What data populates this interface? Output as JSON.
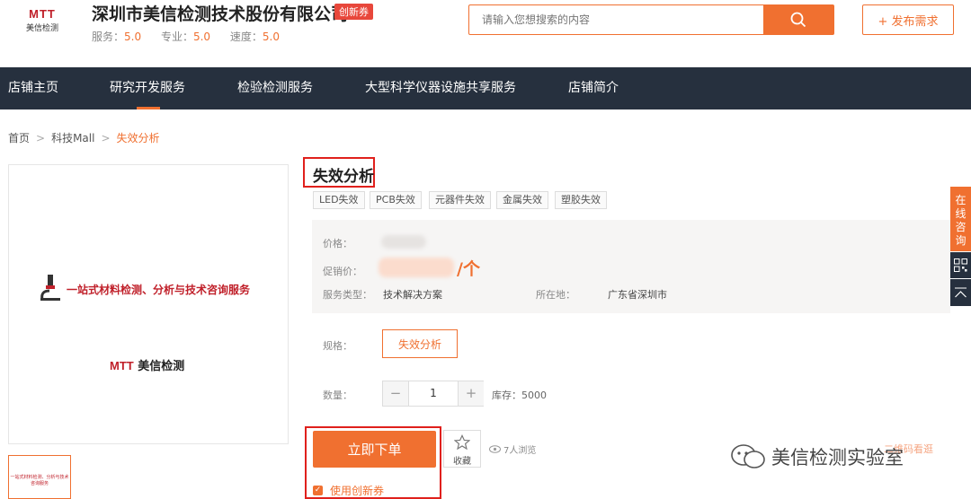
{
  "header": {
    "logo_mark": "MTT",
    "logo_sub": "美信检测",
    "shop_name": "深圳市美信检测技术股份有限公司",
    "badge": "创新券",
    "ratings": [
      {
        "label": "服务：",
        "value": "5.0"
      },
      {
        "label": "专业：",
        "value": "5.0"
      },
      {
        "label": "速度：",
        "value": "5.0"
      }
    ],
    "search_placeholder": "请输入您想搜索的内容",
    "publish_label": "+ 发布需求"
  },
  "nav": {
    "items": [
      "店铺主页",
      "研究开发服务",
      "检验检测服务",
      "大型科学仪器设施共享服务",
      "店铺简介"
    ],
    "active": "研究开发服务"
  },
  "breadcrumb": {
    "items": [
      "首页",
      "科技Mall",
      "失效分析"
    ]
  },
  "gallery": {
    "banner_text": "一站式材料检测、分析与技术咨询服务",
    "logo_mark": "MTT",
    "logo_text": "美信检测",
    "thumb_text": "一站式材料检测、分析与技术咨询服务"
  },
  "product": {
    "title": "失效分析",
    "tags": [
      "LED失效",
      "PCB失效",
      "元器件失效",
      "金属失效",
      "塑胶失效"
    ],
    "price_label": "价格：",
    "promo_label": "促销价：",
    "promo_unit": "/个",
    "service_type_label": "服务类型：",
    "service_type_value": "技术解决方案",
    "location_label": "所在地：",
    "location_value": "广东省深圳市",
    "spec_label": "规格：",
    "spec_value": "失效分析",
    "qty_label": "数量：",
    "qty_minus": "−",
    "qty_value": "1",
    "qty_plus": "+",
    "stock": "库存：5000",
    "buy_label": "立即下单",
    "fav_label": "收藏",
    "views": "7人浏览",
    "coupon_label": "使用创新券"
  },
  "side": {
    "online_consult": "在线咨询"
  },
  "watermark": {
    "text": "美信检测实验室",
    "faint": "二维码看逛"
  },
  "colors": {
    "accent": "#f07030",
    "nav_bg": "#26303e",
    "highlight": "#e0201c"
  }
}
